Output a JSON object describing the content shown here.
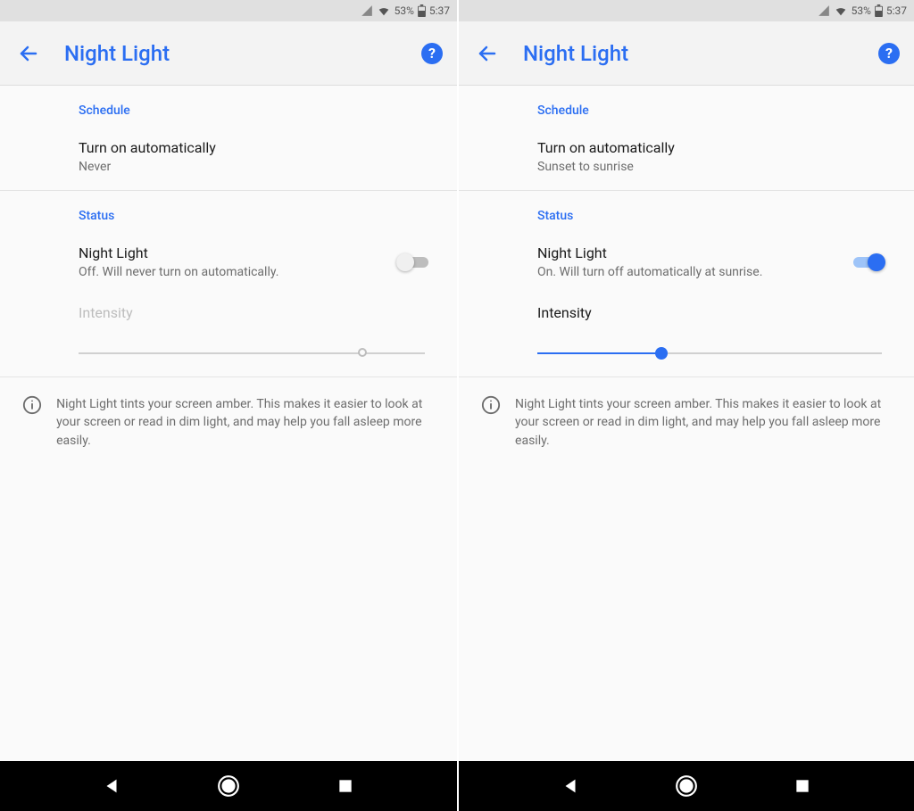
{
  "statusbar": {
    "battery": "53%",
    "time": "5:37"
  },
  "appbar": {
    "title": "Night Light"
  },
  "schedule": {
    "header": "Schedule",
    "row_title": "Turn on automatically"
  },
  "status": {
    "header": "Status",
    "row_title": "Night Light",
    "intensity_label": "Intensity"
  },
  "info": {
    "text": "Night Light tints your screen amber. This makes it easier to look at your screen or read in dim light, and may help you fall asleep more easily."
  },
  "panes": [
    {
      "schedule_value": "Never",
      "status_value": "Off. Will never turn on automatically.",
      "switch_on": false,
      "intensity_enabled": false,
      "slider_percent": 82
    },
    {
      "schedule_value": "Sunset to sunrise",
      "status_value": "On. Will turn off automatically at sunrise.",
      "switch_on": true,
      "intensity_enabled": true,
      "slider_percent": 36
    }
  ]
}
